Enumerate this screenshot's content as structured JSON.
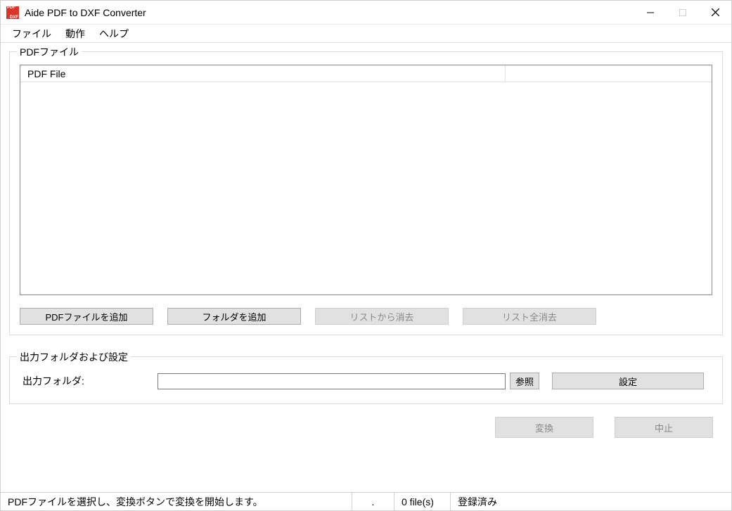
{
  "window": {
    "title": "Aide PDF to DXF Converter"
  },
  "menu": {
    "file": "ファイル",
    "action": "動作",
    "help": "ヘルプ"
  },
  "group_pdf": {
    "legend": "PDFファイル",
    "column_header": "PDF File",
    "btn_add_pdf": "PDFファイルを追加",
    "btn_add_folder": "フォルダを追加",
    "btn_remove": "リストから消去",
    "btn_clear": "リスト全消去"
  },
  "group_output": {
    "legend": "出力フォルダおよび設定",
    "label": "出力フォルダ:",
    "value": "",
    "btn_browse": "参照",
    "btn_settings": "設定"
  },
  "actions": {
    "convert": "変換",
    "stop": "中止"
  },
  "status": {
    "message": "PDFファイルを選択し、変換ボタンで変換を開始します。",
    "progress": ".",
    "file_count": "0 file(s)",
    "registration": "登録済み"
  }
}
